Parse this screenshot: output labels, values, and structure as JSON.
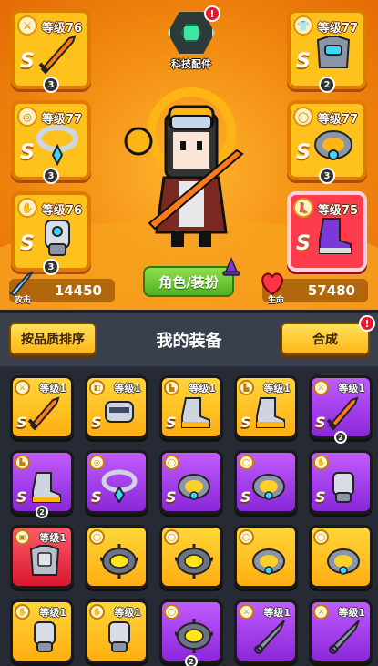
{
  "hero": {
    "tech_label": "科技配件",
    "tech_alert": "!",
    "role_button": "角色/装扮",
    "attack": {
      "caption": "攻击",
      "value": "14450"
    },
    "hp": {
      "caption": "生命",
      "value": "57480"
    },
    "slots": [
      {
        "id": "weapon",
        "level": "等级76",
        "rank": "S",
        "stars": "3",
        "icon": "sword-icon",
        "quality": "rare"
      },
      {
        "id": "necklace",
        "level": "等级77",
        "rank": "S",
        "stars": "3",
        "icon": "necklace-icon",
        "quality": "rare"
      },
      {
        "id": "gloves",
        "level": "等级76",
        "rank": "S",
        "stars": "3",
        "icon": "gauntlet-icon",
        "quality": "rare"
      },
      {
        "id": "armor",
        "level": "等级77",
        "rank": "S",
        "stars": "2",
        "icon": "armor-icon",
        "quality": "rare"
      },
      {
        "id": "belt",
        "level": "等级77",
        "rank": "S",
        "stars": "3",
        "icon": "belt-icon",
        "quality": "rare"
      },
      {
        "id": "boots",
        "level": "等级75",
        "rank": "S",
        "stars": "",
        "icon": "boots-icon",
        "quality": "epic"
      }
    ]
  },
  "inventory": {
    "title": "我的装备",
    "sort_button": "按品质排序",
    "merge_button": "合成",
    "merge_alert": "!",
    "items": [
      {
        "level": "等级1",
        "rank": "S",
        "stars": "",
        "icon": "sword-icon",
        "quality": "rare"
      },
      {
        "level": "等级1",
        "rank": "S",
        "stars": "",
        "icon": "bracer-icon",
        "quality": "rare"
      },
      {
        "level": "等级1",
        "rank": "S",
        "stars": "",
        "icon": "boots-icon",
        "quality": "rare"
      },
      {
        "level": "等级1",
        "rank": "S",
        "stars": "",
        "icon": "boots-icon",
        "quality": "rare"
      },
      {
        "level": "等级1",
        "rank": "S",
        "stars": "2",
        "icon": "sword-icon",
        "quality": "epic"
      },
      {
        "level": "",
        "rank": "S",
        "stars": "2",
        "icon": "boots-icon",
        "quality": "epic"
      },
      {
        "level": "",
        "rank": "S",
        "stars": "",
        "icon": "necklace-icon",
        "quality": "epic"
      },
      {
        "level": "",
        "rank": "S",
        "stars": "",
        "icon": "belt-icon",
        "quality": "epic"
      },
      {
        "level": "",
        "rank": "S",
        "stars": "",
        "icon": "belt-icon",
        "quality": "epic"
      },
      {
        "level": "",
        "rank": "S",
        "stars": "",
        "icon": "gauntlet-icon",
        "quality": "epic"
      },
      {
        "level": "等级1",
        "rank": "",
        "stars": "",
        "icon": "armor-icon",
        "quality": "legend"
      },
      {
        "level": "",
        "rank": "",
        "stars": "",
        "icon": "spiked-ring-icon",
        "quality": "rare"
      },
      {
        "level": "",
        "rank": "",
        "stars": "",
        "icon": "spiked-ring-icon",
        "quality": "rare"
      },
      {
        "level": "",
        "rank": "",
        "stars": "",
        "icon": "belt-icon",
        "quality": "rare"
      },
      {
        "level": "",
        "rank": "",
        "stars": "",
        "icon": "belt-icon",
        "quality": "rare"
      },
      {
        "level": "等级1",
        "rank": "",
        "stars": "",
        "icon": "gauntlet-icon",
        "quality": "rare"
      },
      {
        "level": "等级1",
        "rank": "",
        "stars": "",
        "icon": "gauntlet-icon",
        "quality": "rare"
      },
      {
        "level": "",
        "rank": "",
        "stars": "2",
        "icon": "spiked-ring-icon",
        "quality": "epic"
      },
      {
        "level": "等级1",
        "rank": "",
        "stars": "",
        "icon": "kunai-icon",
        "quality": "epic"
      },
      {
        "level": "等级1",
        "rank": "",
        "stars": "",
        "icon": "kunai-icon",
        "quality": "epic"
      }
    ]
  }
}
